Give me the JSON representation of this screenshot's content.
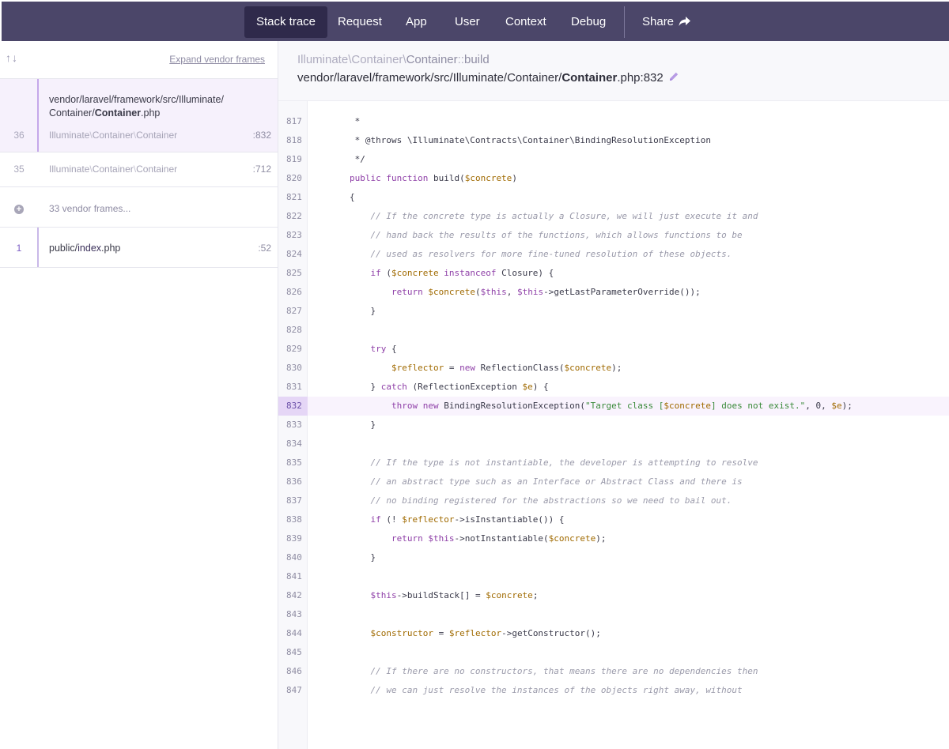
{
  "nav": {
    "tabs": [
      {
        "label": "Stack trace",
        "active": true
      },
      {
        "label": "Request"
      },
      {
        "label": "App"
      },
      {
        "label": "User"
      },
      {
        "label": "Context"
      },
      {
        "label": "Debug"
      }
    ],
    "share_label": "Share"
  },
  "sidebar": {
    "arrows": "↑↓",
    "expand_label": "Expand vendor frames",
    "frames": [
      {
        "number": "",
        "path_line1": "vendor/laravel/framework/src/Illuminate/",
        "path_line2_prefix": "Container/",
        "path_line2_bold": "Container",
        "path_line2_suffix": ".php"
      },
      {
        "number": "36",
        "class_ns1": "Illuminate",
        "class_ns2": "Container",
        "class_name": "Container",
        "line": ":832"
      },
      {
        "number": "35",
        "class_ns1": "Illuminate",
        "class_ns2": "Container",
        "class_name": "Container",
        "line": ":712"
      },
      {
        "vendor_frames": "33 vendor frames..."
      },
      {
        "number": "1",
        "path_prefix": "public/",
        "path_bold": "index",
        "path_suffix": ".php",
        "line": ":52"
      }
    ]
  },
  "main": {
    "method_ns1": "Illuminate",
    "method_ns2": "Container",
    "method_class": "Container",
    "method_sep": "::",
    "method_name": "build",
    "file_prefix": "vendor/laravel/framework/src/Illuminate/Container/",
    "file_bold": "Container",
    "file_suffix": ".php:832",
    "highlighted_line": 832,
    "colors": {
      "keyword": "#8f40a8",
      "variable": "#a06a00",
      "string": "#3a8a3a",
      "comment": "#9a9aaa",
      "function": "#4160b8"
    },
    "code": [
      {
        "n": "817",
        "t": "         *"
      },
      {
        "n": "818",
        "t": "         * @throws \\Illuminate\\Contracts\\Container\\BindingResolutionException"
      },
      {
        "n": "819",
        "t": "         */"
      },
      {
        "n": "820",
        "t": "        public function build($concrete)"
      },
      {
        "n": "821",
        "t": "        {"
      },
      {
        "n": "822",
        "t": "            // If the concrete type is actually a Closure, we will just execute it and"
      },
      {
        "n": "823",
        "t": "            // hand back the results of the functions, which allows functions to be"
      },
      {
        "n": "824",
        "t": "            // used as resolvers for more fine-tuned resolution of these objects."
      },
      {
        "n": "825",
        "t": "            if ($concrete instanceof Closure) {"
      },
      {
        "n": "826",
        "t": "                return $concrete($this, $this->getLastParameterOverride());"
      },
      {
        "n": "827",
        "t": "            }"
      },
      {
        "n": "828",
        "t": ""
      },
      {
        "n": "829",
        "t": "            try {"
      },
      {
        "n": "830",
        "t": "                $reflector = new ReflectionClass($concrete);"
      },
      {
        "n": "831",
        "t": "            } catch (ReflectionException $e) {"
      },
      {
        "n": "832",
        "t": "                throw new BindingResolutionException(\"Target class [$concrete] does not exist.\", 0, $e);"
      },
      {
        "n": "833",
        "t": "            }"
      },
      {
        "n": "834",
        "t": ""
      },
      {
        "n": "835",
        "t": "            // If the type is not instantiable, the developer is attempting to resolve"
      },
      {
        "n": "836",
        "t": "            // an abstract type such as an Interface or Abstract Class and there is"
      },
      {
        "n": "837",
        "t": "            // no binding registered for the abstractions so we need to bail out."
      },
      {
        "n": "838",
        "t": "            if (! $reflector->isInstantiable()) {"
      },
      {
        "n": "839",
        "t": "                return $this->notInstantiable($concrete);"
      },
      {
        "n": "840",
        "t": "            }"
      },
      {
        "n": "841",
        "t": ""
      },
      {
        "n": "842",
        "t": "            $this->buildStack[] = $concrete;"
      },
      {
        "n": "843",
        "t": ""
      },
      {
        "n": "844",
        "t": "            $constructor = $reflector->getConstructor();"
      },
      {
        "n": "845",
        "t": ""
      },
      {
        "n": "846",
        "t": "            // If there are no constructors, that means there are no dependencies then"
      },
      {
        "n": "847",
        "t": "            // we can just resolve the instances of the objects right away, without"
      }
    ]
  }
}
